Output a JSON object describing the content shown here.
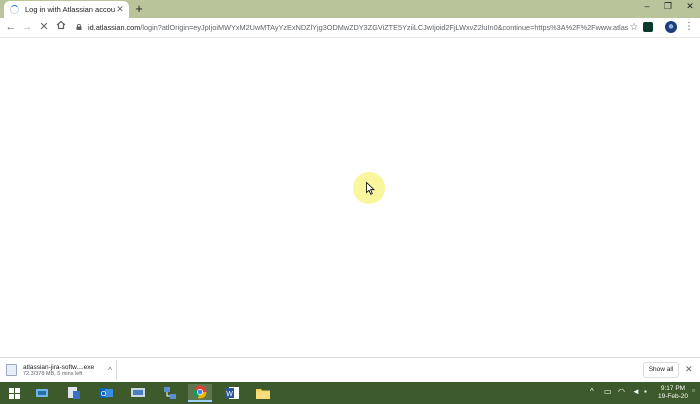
{
  "tab": {
    "title": "Log in with Atlassian account"
  },
  "omnibox": {
    "host": "id.atlassian.com",
    "path": "/login?atlOrigin=eyJpIjoiMWYxM2UwMTAyYzExNDZlYjg3ODMwZDY3ZGViZTE5YziiLCJwIjoid2FjLWxvZ2luIn0&continue=https%3A%2F%2Fwww.atlassi..."
  },
  "download": {
    "filename": "atlassian-jira-softw....exe",
    "status": "72.3/378 MB, 5 mins left",
    "show_all": "Show all"
  },
  "taskbar": {
    "time": "9:17 PM",
    "date": "19-Feb-20"
  }
}
